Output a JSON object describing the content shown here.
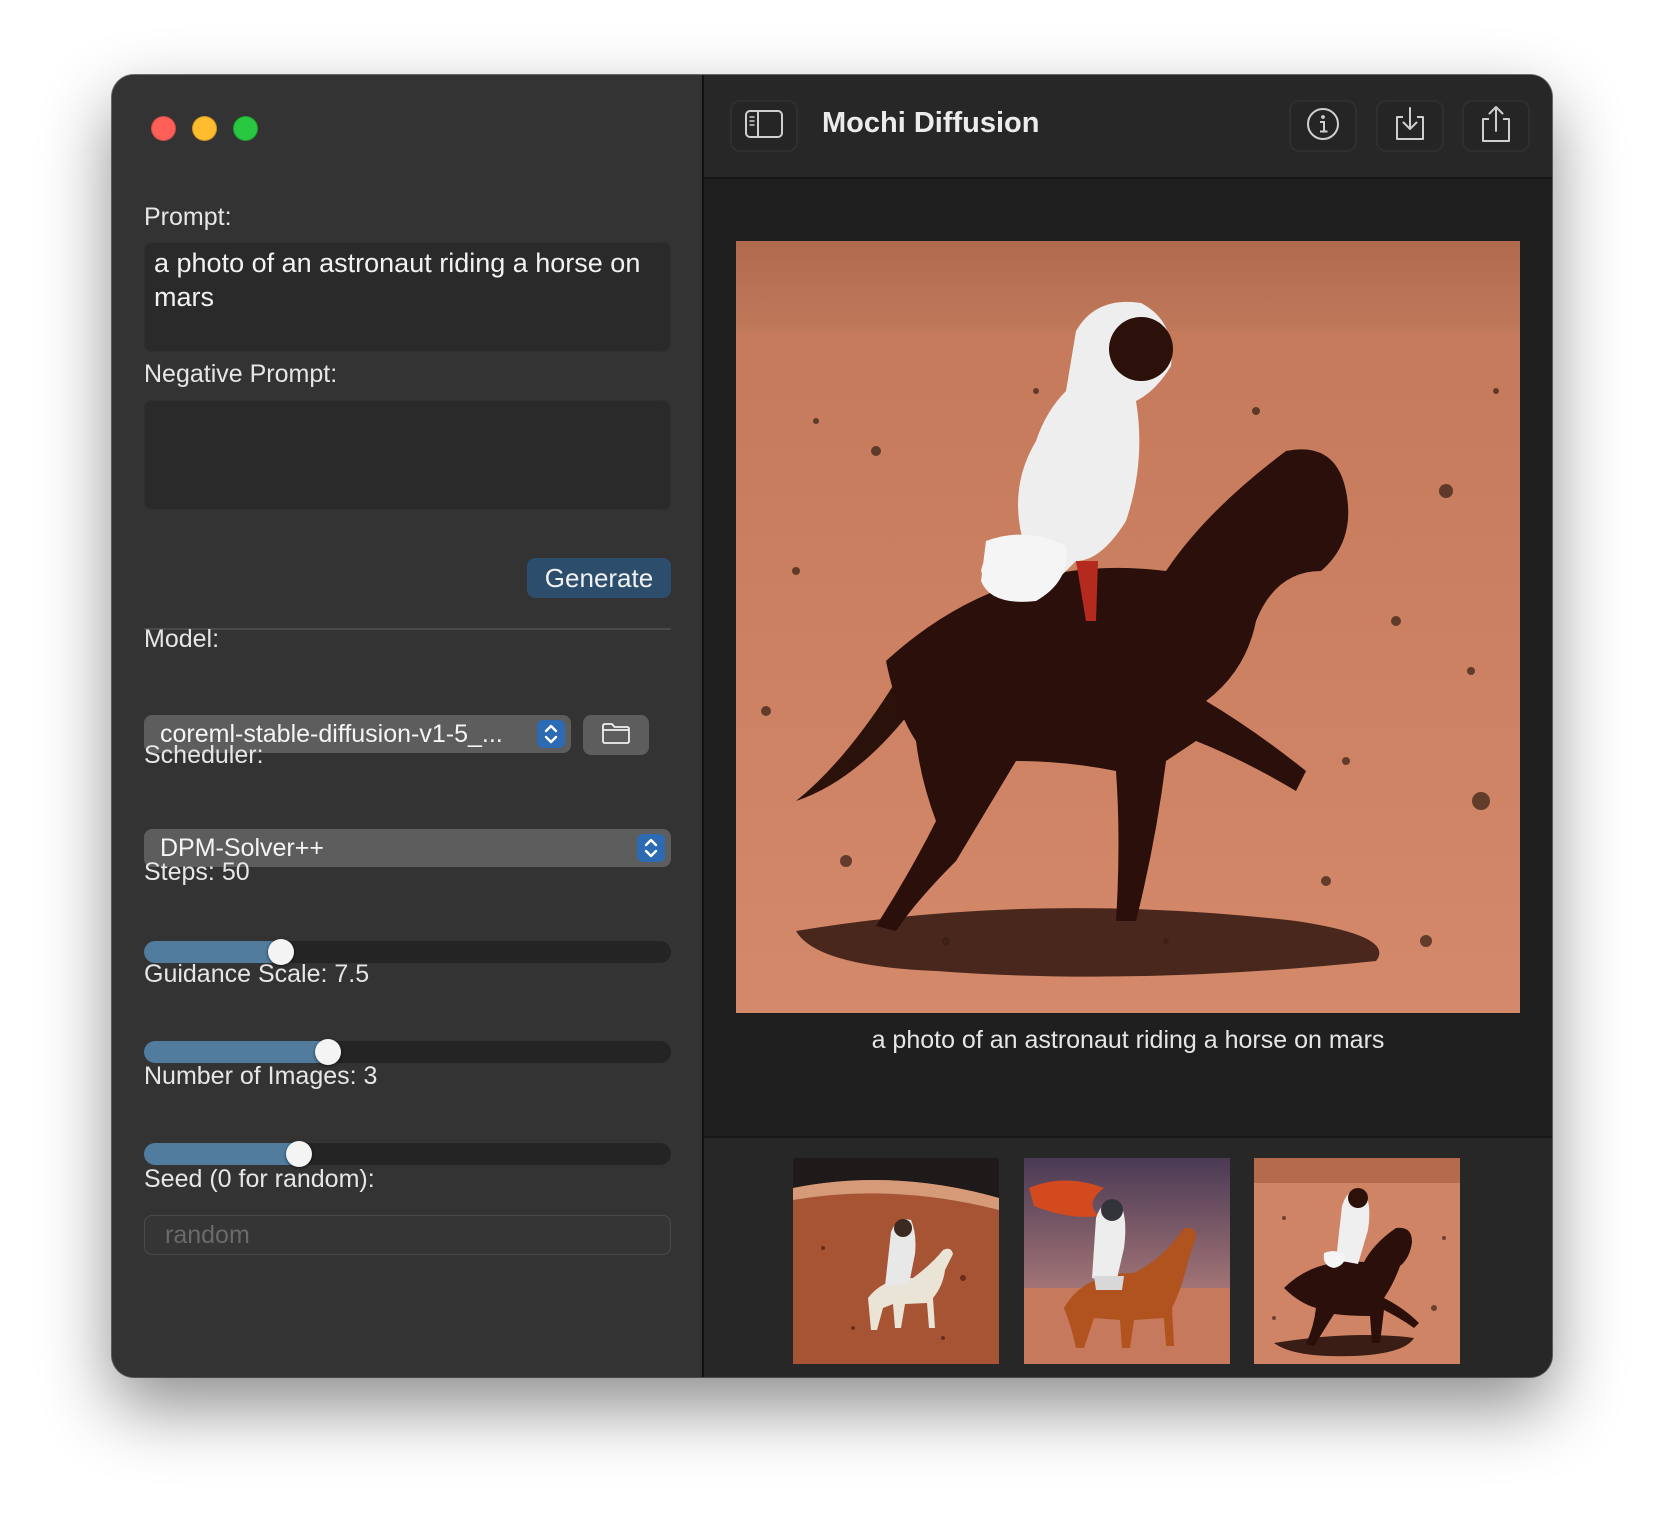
{
  "window": {
    "title": "Mochi Diffusion"
  },
  "sidebar": {
    "prompt_label": "Prompt:",
    "prompt_value": "a photo of an astronaut riding a horse on mars",
    "negative_prompt_label": "Negative Prompt:",
    "negative_prompt_value": "",
    "generate_label": "Generate",
    "model_label": "Model:",
    "model_value": "coreml-stable-diffusion-v1-5_...",
    "scheduler_label": "Scheduler:",
    "scheduler_value": "DPM-Solver++",
    "steps_label": "Steps: 50",
    "steps_fraction": 0.26,
    "guidance_label": "Guidance Scale: 7.5",
    "guidance_fraction": 0.35,
    "images_label": "Number of Images: 3",
    "images_fraction": 0.295,
    "seed_label": "Seed (0 for random):",
    "seed_placeholder": "random"
  },
  "main": {
    "caption": "a photo of an astronaut riding a horse on mars",
    "thumbnails": [
      {
        "name": "thumbnail-white-horse"
      },
      {
        "name": "thumbnail-brown-horse"
      },
      {
        "name": "thumbnail-dark-horse"
      }
    ]
  },
  "icons": {
    "sidebar_toggle": "sidebar-toggle-icon",
    "info": "info-icon",
    "save": "save-icon",
    "share": "share-icon",
    "folder": "folder-icon",
    "chevrons": "up-down-chevron-icon"
  },
  "colors": {
    "accent": "#2c6ab3",
    "slider_fill": "#517c9e",
    "generate_button": "#2c4d6c",
    "close": "#fe5f57",
    "minimize": "#febc2e",
    "zoom": "#28c840"
  }
}
